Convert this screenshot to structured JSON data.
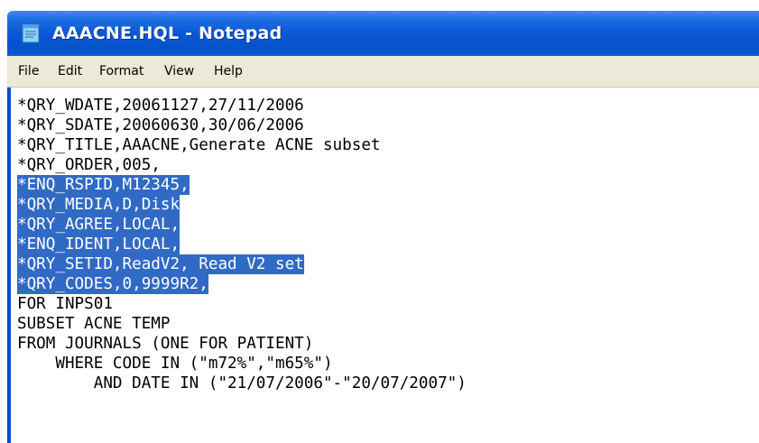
{
  "window": {
    "title": "AAACNE.HQL - Notepad",
    "app_icon": "notepad-icon",
    "titlebar_color": "#0a58d6"
  },
  "menubar": {
    "items": [
      {
        "label": "File"
      },
      {
        "label": "Edit"
      },
      {
        "label": "Format"
      },
      {
        "label": "View"
      },
      {
        "label": "Help"
      }
    ]
  },
  "editor": {
    "selection_color": "#316ac5",
    "lines": [
      {
        "text": "*QRY_WDATE,20061127,27/11/2006",
        "selected": false
      },
      {
        "text": "*QRY_SDATE,20060630,30/06/2006",
        "selected": false
      },
      {
        "text": "*QRY_TITLE,AAACNE,Generate ACNE subset",
        "selected": false
      },
      {
        "text": "*QRY_ORDER,005,",
        "selected": false
      },
      {
        "text": "*ENQ_RSPID,M12345,",
        "selected": true
      },
      {
        "text": "*QRY_MEDIA,D,Disk",
        "selected": true
      },
      {
        "text": "*QRY_AGREE,LOCAL,",
        "selected": true
      },
      {
        "text": "*ENQ_IDENT,LOCAL,",
        "selected": true
      },
      {
        "text": "*QRY_SETID,ReadV2, Read V2 set",
        "selected": true
      },
      {
        "text": "*QRY_CODES,0,9999R2,",
        "selected": true
      },
      {
        "text": "FOR INPS01",
        "selected": false
      },
      {
        "text": "SUBSET ACNE TEMP",
        "selected": false
      },
      {
        "text": "FROM JOURNALS (ONE FOR PATIENT)",
        "selected": false
      },
      {
        "text": "    WHERE CODE IN (\"m72%\",\"m65%\")",
        "selected": false
      },
      {
        "text": "        AND DATE IN (\"21/07/2006\"-\"20/07/2007\")",
        "selected": false
      }
    ]
  }
}
